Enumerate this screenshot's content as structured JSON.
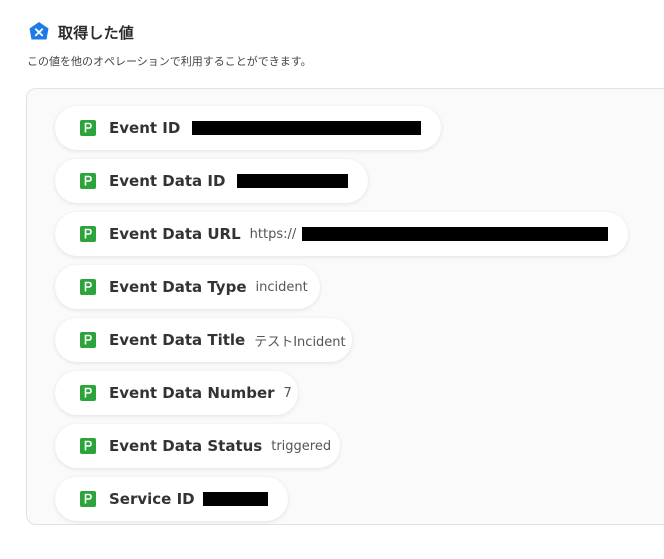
{
  "header": {
    "title": "取得した値",
    "description": "この値を他のオペレーションで利用することができます。",
    "icon": "yoom-x-icon",
    "icon_color": "#1e7be6"
  },
  "values": [
    {
      "label": "Event ID",
      "value": ""
    },
    {
      "label": "Event Data ID",
      "value": ""
    },
    {
      "label": "Event Data URL",
      "value": "https://"
    },
    {
      "label": "Event Data Type",
      "value": "incident"
    },
    {
      "label": "Event Data Title",
      "value": "テストIncident"
    },
    {
      "label": "Event Data Number",
      "value": "7"
    },
    {
      "label": "Event Data Status",
      "value": "triggered"
    },
    {
      "label": "Service ID",
      "value": ""
    }
  ],
  "chip_icon": "pagerduty-icon",
  "chip_icon_color": "#2ca33b"
}
